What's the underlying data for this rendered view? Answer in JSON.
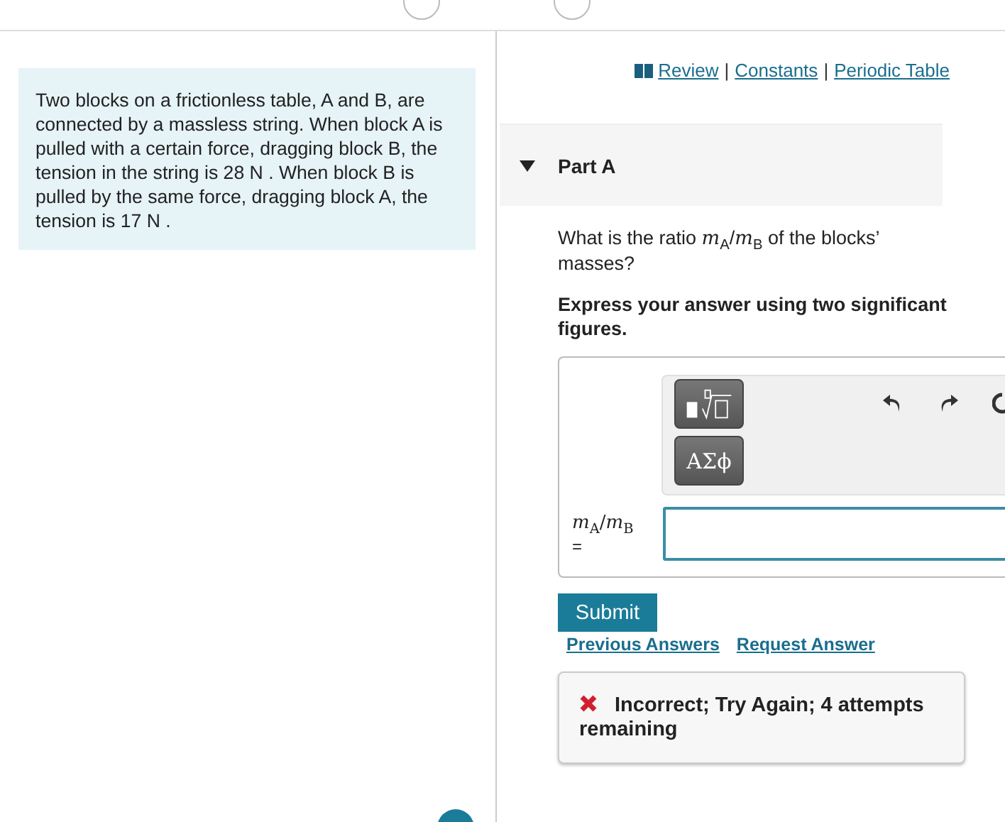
{
  "resource_links": [
    "Review",
    "Constants",
    "Periodic Table"
  ],
  "link_separator": "|",
  "problem": {
    "text": "Two blocks on a frictionless table, A and B, are connected by a massless string. When block A is pulled with a certain force, dragging block B, the tension in the string is 28  N . When block B is pulled by the same force, dragging block A, the tension is 17  N ."
  },
  "part": {
    "title": "Part A",
    "expanded": true,
    "question": "What is the ratio *m*$_{A}$/*m*$_{B}$ of the blocks’ masses?",
    "instruction": "Express your answer using two significant figures.",
    "toolbar": {
      "symbol_button": "ΑΣϕ"
    },
    "answer_label": "*m*$_{A}$/*m*$_{B}$",
    "answer_equals": "=",
    "submit": "Submit",
    "links": [
      "Previous Answers",
      "Request Answer"
    ],
    "feedback": {
      "kind": "incorrect",
      "text": "Incorrect; Try Again; 4 attempts remaining"
    }
  }
}
